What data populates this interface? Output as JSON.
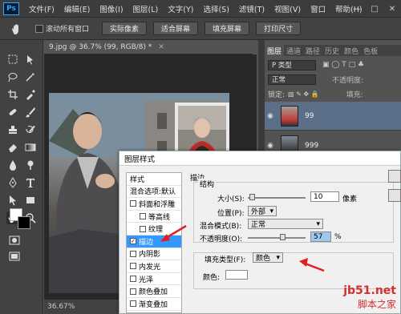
{
  "app": {
    "logo": "Ps"
  },
  "menu": [
    "文件(F)",
    "编辑(E)",
    "图像(I)",
    "图层(L)",
    "文字(Y)",
    "选择(S)",
    "滤镜(T)",
    "视图(V)",
    "窗口",
    "帮助(H)"
  ],
  "options": {
    "scroll_all_label": "滚动所有窗口",
    "buttons": [
      "实际像素",
      "适合屏幕",
      "填充屏幕",
      "打印尺寸"
    ]
  },
  "document": {
    "tab_title": "9.jpg @ 36.7% (99, RGB/8) *",
    "zoom": "36.67%"
  },
  "panel": {
    "tabs": [
      "图层",
      "通道",
      "路径",
      "历史",
      "颜色",
      "色板"
    ],
    "kind_label": "P 类型",
    "blend_mode": "正常",
    "opacity_label": "不透明度:",
    "lock_label": "锁定:",
    "fill_label": "填充:",
    "layers": [
      {
        "name": "99"
      },
      {
        "name": "999"
      }
    ]
  },
  "dialog": {
    "title": "图层样式",
    "left_items": [
      {
        "label": "样式",
        "checkbox": false,
        "checked": false
      },
      {
        "label": "混合选项:默认",
        "checkbox": false,
        "checked": false
      },
      {
        "label": "斜面和浮雕",
        "checkbox": true,
        "checked": false
      },
      {
        "label": "等高线",
        "checkbox": true,
        "checked": false
      },
      {
        "label": "纹理",
        "checkbox": true,
        "checked": false
      },
      {
        "label": "描边",
        "checkbox": true,
        "checked": true
      },
      {
        "label": "内阴影",
        "checkbox": true,
        "checked": false
      },
      {
        "label": "内发光",
        "checkbox": true,
        "checked": false
      },
      {
        "label": "光泽",
        "checkbox": true,
        "checked": false
      },
      {
        "label": "颜色叠加",
        "checkbox": true,
        "checked": false
      },
      {
        "label": "渐变叠加",
        "checkbox": true,
        "checked": false
      }
    ],
    "section": "描边",
    "structure": "结构",
    "size_label": "大小(S):",
    "size_value": "10",
    "size_unit": "像素",
    "position_label": "位置(P):",
    "position_value": "外部",
    "blend_label": "混合模式(B):",
    "blend_value": "正常",
    "opacity_label": "不透明度(O):",
    "opacity_value": "57",
    "opacity_unit": "%",
    "fill_type_label": "填充类型(F):",
    "fill_type_value": "颜色",
    "color_label": "颜色:",
    "stroke_color": "#ffffff"
  },
  "watermark": {
    "site": "jb51.net",
    "name": "脚本之家"
  },
  "colors": {
    "accent": "#3399ff",
    "annotation": "#e02020"
  }
}
